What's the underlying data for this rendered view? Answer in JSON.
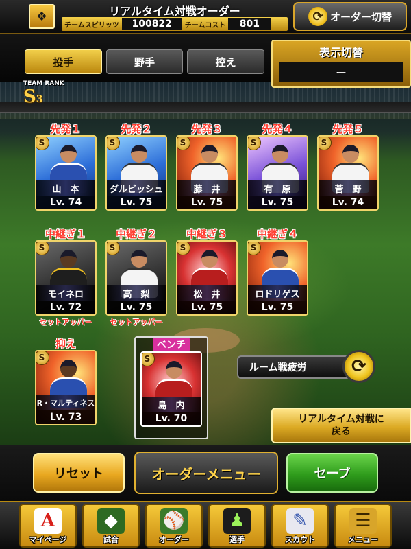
{
  "header": {
    "title": "リアルタイム対戦オーダー",
    "team_spirit_label": "チームスピリッツ",
    "team_spirit_value": "100822",
    "team_cost_label": "チームコスト",
    "team_cost_value": "801",
    "order_switch_label": "オーダー切替"
  },
  "tabs": [
    {
      "label": "投手",
      "active": true
    },
    {
      "label": "野手",
      "active": false
    },
    {
      "label": "控え",
      "active": false
    }
  ],
  "display_toggle": {
    "title": "表示切替",
    "value": "ー"
  },
  "team_rank": {
    "label": "TEAM RANK",
    "rank": "S",
    "sub": "3"
  },
  "starters": [
    {
      "slot": "先発１",
      "name": "山　本",
      "level": "Lv. 74",
      "badge": "S"
    },
    {
      "slot": "先発２",
      "name": "ダルビッシュ",
      "level": "Lv. 75",
      "badge": "S"
    },
    {
      "slot": "先発３",
      "name": "藤　井",
      "level": "Lv. 75",
      "badge": "S"
    },
    {
      "slot": "先発４",
      "name": "有　原",
      "level": "Lv. 75",
      "badge": "S"
    },
    {
      "slot": "先発５",
      "name": "菅　野",
      "level": "Lv. 74",
      "badge": "S"
    }
  ],
  "relievers": [
    {
      "slot": "中継ぎ１",
      "name": "モイネロ",
      "level": "Lv. 72",
      "badge": "S",
      "note": "セットアッパー"
    },
    {
      "slot": "中継ぎ２",
      "name": "高　梨",
      "level": "Lv. 75",
      "badge": "S",
      "note": "セットアッパー"
    },
    {
      "slot": "中継ぎ３",
      "name": "松　井",
      "level": "Lv. 75",
      "badge": "S",
      "note": ""
    },
    {
      "slot": "中継ぎ４",
      "name": "ロドリゲス",
      "level": "Lv. 75",
      "badge": "S",
      "note": ""
    }
  ],
  "closer": {
    "slot": "抑え",
    "name": "R・マルティネス",
    "level": "Lv. 73",
    "badge": "S"
  },
  "bench": {
    "slot": "ベンチ",
    "name": "島　内",
    "level": "Lv. 70",
    "badge": "S"
  },
  "room_fatigue_label": "ルーム戦疲労",
  "return_button": {
    "line1": "リアルタイム対戦に",
    "line2": "戻る"
  },
  "actions": {
    "reset": "リセット",
    "order_menu": "オーダーメニュー",
    "save": "セーブ"
  },
  "nav": [
    {
      "label": "マイページ",
      "icon": "mypage-icon"
    },
    {
      "label": "試合",
      "icon": "stadium-icon"
    },
    {
      "label": "オーダー",
      "icon": "order-icon"
    },
    {
      "label": "選手",
      "icon": "player-icon"
    },
    {
      "label": "スカウト",
      "icon": "scout-icon"
    },
    {
      "label": "メニュー",
      "icon": "menu-icon"
    }
  ]
}
